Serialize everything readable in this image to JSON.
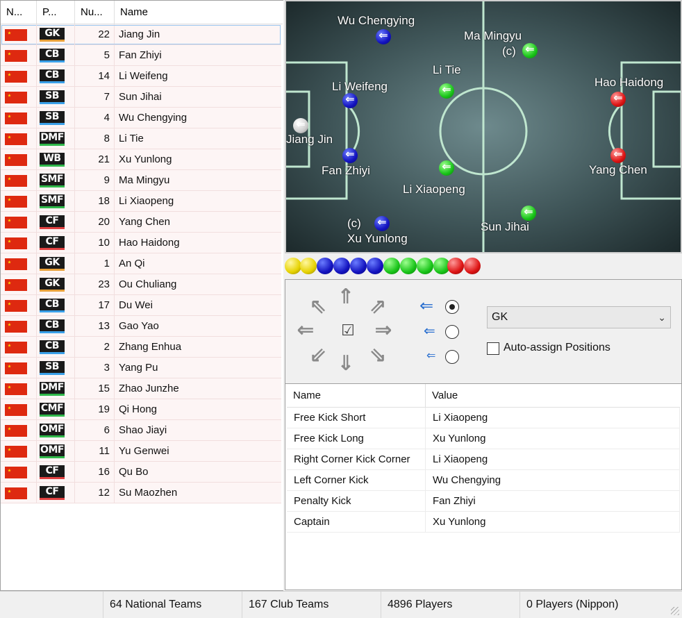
{
  "roster": {
    "headers": [
      "N...",
      "P...",
      "Nu...",
      "Name"
    ],
    "players": [
      {
        "pos": "GK",
        "number": "22",
        "name": "Jiang Jin",
        "bar": "#e8a13a"
      },
      {
        "pos": "CB",
        "number": "5",
        "name": "Fan Zhiyi",
        "bar": "#3aa0e8"
      },
      {
        "pos": "CB",
        "number": "14",
        "name": "Li Weifeng",
        "bar": "#3aa0e8"
      },
      {
        "pos": "SB",
        "number": "7",
        "name": "Sun Jihai",
        "bar": "#3aa0e8"
      },
      {
        "pos": "SB",
        "number": "4",
        "name": "Wu Chengying",
        "bar": "#3aa0e8"
      },
      {
        "pos": "DMF",
        "number": "8",
        "name": "Li Tie",
        "bar": "#2fb84a"
      },
      {
        "pos": "WB",
        "number": "21",
        "name": "Xu Yunlong",
        "bar": "#2fb84a"
      },
      {
        "pos": "SMF",
        "number": "9",
        "name": "Ma Mingyu",
        "bar": "#2fb84a"
      },
      {
        "pos": "SMF",
        "number": "18",
        "name": "Li Xiaopeng",
        "bar": "#2fb84a"
      },
      {
        "pos": "CF",
        "number": "20",
        "name": "Yang Chen",
        "bar": "#e04040"
      },
      {
        "pos": "CF",
        "number": "10",
        "name": "Hao Haidong",
        "bar": "#e04040"
      },
      {
        "pos": "GK",
        "number": "1",
        "name": "An Qi",
        "bar": "#e8a13a"
      },
      {
        "pos": "GK",
        "number": "23",
        "name": "Ou Chuliang",
        "bar": "#e8a13a"
      },
      {
        "pos": "CB",
        "number": "17",
        "name": "Du Wei",
        "bar": "#3aa0e8"
      },
      {
        "pos": "CB",
        "number": "13",
        "name": "Gao Yao",
        "bar": "#3aa0e8"
      },
      {
        "pos": "CB",
        "number": "2",
        "name": "Zhang Enhua",
        "bar": "#3aa0e8"
      },
      {
        "pos": "SB",
        "number": "3",
        "name": "Yang Pu",
        "bar": "#3aa0e8"
      },
      {
        "pos": "DMF",
        "number": "15",
        "name": "Zhao Junzhe",
        "bar": "#2fb84a"
      },
      {
        "pos": "CMF",
        "number": "19",
        "name": "Qi Hong",
        "bar": "#2fb84a"
      },
      {
        "pos": "OMF",
        "number": "6",
        "name": "Shao Jiayi",
        "bar": "#2fb84a"
      },
      {
        "pos": "OMF",
        "number": "11",
        "name": "Yu Genwei",
        "bar": "#2fb84a"
      },
      {
        "pos": "CF",
        "number": "16",
        "name": "Qu Bo",
        "bar": "#e04040"
      },
      {
        "pos": "CF",
        "number": "12",
        "name": "Su Maozhen",
        "bar": "#e04040"
      }
    ]
  },
  "pitch": {
    "labels": {
      "wu_chengying": "Wu Chengying",
      "ma_mingyu": "Ma Mingyu",
      "ma_captain": "(c)",
      "li_tie": "Li Tie",
      "li_weifeng": "Li Weifeng",
      "hao_haidong": "Hao Haidong",
      "jiang_jin": "Jiang Jin",
      "fan_zhiyi": "Fan Zhiyi",
      "yang_chen": "Yang Chen",
      "li_xiaopeng": "Li Xiaopeng",
      "xu_captain": "(c)",
      "xu_yunlong": "Xu Yunlong",
      "sun_jihai": "Sun Jihai"
    }
  },
  "controls": {
    "position_select": "GK",
    "auto_assign_label": "Auto-assign Positions",
    "auto_assign_checked": false,
    "center_checkbox": "☑"
  },
  "set_pieces": {
    "headers": {
      "name": "Name",
      "value": "Value"
    },
    "rows": [
      {
        "name": "Free Kick Short",
        "value": "Li Xiaopeng"
      },
      {
        "name": "Free Kick Long",
        "value": "Xu Yunlong"
      },
      {
        "name": "Right Corner Kick Corner",
        "value": "Li Xiaopeng"
      },
      {
        "name": "Left Corner Kick",
        "value": "Wu Chengying"
      },
      {
        "name": "Penalty Kick",
        "value": "Fan Zhiyi"
      },
      {
        "name": "Captain",
        "value": "Xu Yunlong"
      }
    ]
  },
  "status": {
    "national_teams": "64 National Teams",
    "club_teams": "167 Club Teams",
    "players": "4896 Players",
    "nippon": "0 Players (Nippon)"
  }
}
